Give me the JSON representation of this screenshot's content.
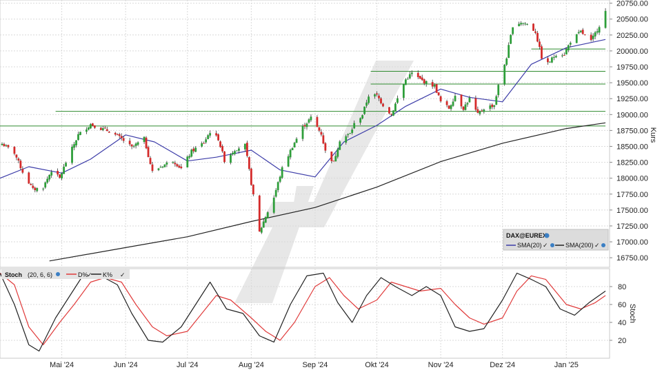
{
  "chart_data": [
    {
      "type": "candlestick",
      "instrument": "DAX@EUREX",
      "ylabel": "Kurs",
      "ylim": [
        16600,
        20800
      ],
      "yticks": [
        16750,
        17000,
        17250,
        17500,
        17750,
        18000,
        18250,
        18500,
        18750,
        19000,
        19250,
        19500,
        19750,
        20000,
        20250,
        20500,
        20750
      ],
      "ytick_labels": [
        "16750.00",
        "17000.00",
        "17250.00",
        "17500.00",
        "17750.00",
        "18000.00",
        "18250.00",
        "18500.00",
        "18750.00",
        "19000.00",
        "19250.00",
        "19500.00",
        "19750.00",
        "20000.00",
        "20250.00",
        "20500.00",
        "20750.00"
      ],
      "xlim": [
        "2024-04-01",
        "2025-01-22"
      ],
      "xticks": [
        "2024-05-01",
        "2024-06-01",
        "2024-07-01",
        "2024-08-01",
        "2024-09-01",
        "2024-10-01",
        "2024-11-01",
        "2024-12-01",
        "2025-01-01"
      ],
      "xtick_labels": [
        "Mai '24",
        "Jun '24",
        "Jul '24",
        "Aug '24",
        "Sep '24",
        "Okt '24",
        "Nov '24",
        "Dez '24",
        "Jan '25"
      ],
      "grid": true,
      "up_color": "#2e9e3a",
      "down_color": "#d42a2a",
      "close_points": [
        [
          "2024-04-02",
          18540
        ],
        [
          "2024-04-08",
          18400
        ],
        [
          "2024-04-12",
          18100
        ],
        [
          "2024-04-17",
          17820
        ],
        [
          "2024-04-22",
          17860
        ],
        [
          "2024-04-26",
          18120
        ],
        [
          "2024-04-30",
          18000
        ],
        [
          "2024-05-03",
          18250
        ],
        [
          "2024-05-09",
          18680
        ],
        [
          "2024-05-15",
          18850
        ],
        [
          "2024-05-20",
          18780
        ],
        [
          "2024-05-24",
          18740
        ],
        [
          "2024-05-30",
          18620
        ],
        [
          "2024-06-04",
          18480
        ],
        [
          "2024-06-10",
          18620
        ],
        [
          "2024-06-14",
          18100
        ],
        [
          "2024-06-19",
          18200
        ],
        [
          "2024-06-24",
          18280
        ],
        [
          "2024-06-28",
          18150
        ],
        [
          "2024-07-03",
          18420
        ],
        [
          "2024-07-09",
          18560
        ],
        [
          "2024-07-12",
          18730
        ],
        [
          "2024-07-16",
          18620
        ],
        [
          "2024-07-19",
          18280
        ],
        [
          "2024-07-24",
          18450
        ],
        [
          "2024-07-29",
          18520
        ],
        [
          "2024-08-02",
          17720
        ],
        [
          "2024-08-05",
          17150
        ],
        [
          "2024-08-08",
          17400
        ],
        [
          "2024-08-12",
          17700
        ],
        [
          "2024-08-16",
          18150
        ],
        [
          "2024-08-21",
          18500
        ],
        [
          "2024-08-26",
          18800
        ],
        [
          "2024-08-30",
          18950
        ],
        [
          "2024-09-04",
          18700
        ],
        [
          "2024-09-06",
          18420
        ],
        [
          "2024-09-10",
          18250
        ],
        [
          "2024-09-13",
          18600
        ],
        [
          "2024-09-18",
          18700
        ],
        [
          "2024-09-20",
          18850
        ],
        [
          "2024-09-24",
          19000
        ],
        [
          "2024-09-27",
          19300
        ],
        [
          "2024-10-01",
          19300
        ],
        [
          "2024-10-04",
          19150
        ],
        [
          "2024-10-08",
          19000
        ],
        [
          "2024-10-11",
          19250
        ],
        [
          "2024-10-15",
          19550
        ],
        [
          "2024-10-18",
          19650
        ],
        [
          "2024-10-22",
          19550
        ],
        [
          "2024-10-25",
          19500
        ],
        [
          "2024-10-29",
          19450
        ],
        [
          "2024-11-01",
          19200
        ],
        [
          "2024-11-05",
          19100
        ],
        [
          "2024-11-08",
          19300
        ],
        [
          "2024-11-12",
          19100
        ],
        [
          "2024-11-15",
          19250
        ],
        [
          "2024-11-19",
          19000
        ],
        [
          "2024-11-22",
          19100
        ],
        [
          "2024-11-27",
          19150
        ],
        [
          "2024-11-29",
          19450
        ],
        [
          "2024-12-03",
          19900
        ],
        [
          "2024-12-06",
          20400
        ],
        [
          "2024-12-10",
          20450
        ],
        [
          "2024-12-13",
          20420
        ],
        [
          "2024-12-17",
          20300
        ],
        [
          "2024-12-20",
          19900
        ],
        [
          "2024-12-23",
          19800
        ],
        [
          "2024-12-27",
          19950
        ],
        [
          "2024-12-31",
          19950
        ],
        [
          "2025-01-03",
          20150
        ],
        [
          "2025-01-08",
          20300
        ],
        [
          "2025-01-13",
          20150
        ],
        [
          "2025-01-17",
          20400
        ],
        [
          "2025-01-20",
          20620
        ]
      ],
      "series": [
        {
          "name": "SMA(20)",
          "color": "#3c3ca8",
          "values": [
            [
              "2024-04-01",
              18000
            ],
            [
              "2024-04-15",
              18180
            ],
            [
              "2024-05-01",
              18080
            ],
            [
              "2024-05-15",
              18300
            ],
            [
              "2024-06-01",
              18680
            ],
            [
              "2024-06-15",
              18570
            ],
            [
              "2024-07-01",
              18270
            ],
            [
              "2024-07-15",
              18330
            ],
            [
              "2024-08-01",
              18440
            ],
            [
              "2024-08-15",
              18130
            ],
            [
              "2024-09-01",
              18020
            ],
            [
              "2024-09-15",
              18570
            ],
            [
              "2024-10-01",
              18830
            ],
            [
              "2024-10-15",
              19130
            ],
            [
              "2024-11-01",
              19400
            ],
            [
              "2024-11-15",
              19270
            ],
            [
              "2024-12-01",
              19200
            ],
            [
              "2024-12-15",
              19790
            ],
            [
              "2025-01-01",
              20050
            ],
            [
              "2025-01-20",
              20180
            ]
          ]
        },
        {
          "name": "SMA(200)",
          "color": "#222222",
          "values": [
            [
              "2024-04-25",
              16700
            ],
            [
              "2024-06-01",
              16910
            ],
            [
              "2024-07-01",
              17080
            ],
            [
              "2024-08-01",
              17320
            ],
            [
              "2024-09-01",
              17540
            ],
            [
              "2024-10-01",
              17860
            ],
            [
              "2024-11-01",
              18260
            ],
            [
              "2024-12-01",
              18550
            ],
            [
              "2025-01-01",
              18780
            ],
            [
              "2025-01-20",
              18870
            ]
          ]
        }
      ],
      "support_lines": [
        {
          "value": 19680,
          "from": "2024-09-28"
        },
        {
          "value": 19480,
          "from": "2024-09-28"
        },
        {
          "value": 19050,
          "from": "2024-04-28"
        },
        {
          "value": 18820,
          "from": "2024-04-01"
        },
        {
          "value": 20030,
          "from": "2024-12-15"
        }
      ]
    },
    {
      "type": "line",
      "indicator": "Stoch",
      "ylabel": "Stoch",
      "ylim": [
        0,
        100
      ],
      "yticks": [
        20,
        40,
        60,
        80
      ],
      "ytick_labels": [
        "20",
        "40",
        "60",
        "80"
      ],
      "grid": true,
      "series": [
        {
          "name": "D%",
          "color": "#e03a3a",
          "values": [
            [
              "2024-04-01",
              95
            ],
            [
              "2024-04-08",
              82
            ],
            [
              "2024-04-15",
              35
            ],
            [
              "2024-04-22",
              15
            ],
            [
              "2024-04-30",
              40
            ],
            [
              "2024-05-07",
              60
            ],
            [
              "2024-05-15",
              85
            ],
            [
              "2024-05-22",
              90
            ],
            [
              "2024-05-30",
              85
            ],
            [
              "2024-06-06",
              60
            ],
            [
              "2024-06-14",
              35
            ],
            [
              "2024-06-21",
              25
            ],
            [
              "2024-07-01",
              30
            ],
            [
              "2024-07-08",
              50
            ],
            [
              "2024-07-15",
              70
            ],
            [
              "2024-07-22",
              65
            ],
            [
              "2024-08-01",
              45
            ],
            [
              "2024-08-08",
              30
            ],
            [
              "2024-08-15",
              20
            ],
            [
              "2024-08-22",
              40
            ],
            [
              "2024-09-01",
              80
            ],
            [
              "2024-09-08",
              90
            ],
            [
              "2024-09-15",
              70
            ],
            [
              "2024-09-22",
              55
            ],
            [
              "2024-10-01",
              65
            ],
            [
              "2024-10-08",
              85
            ],
            [
              "2024-10-15",
              80
            ],
            [
              "2024-10-22",
              75
            ],
            [
              "2024-11-01",
              78
            ],
            [
              "2024-11-08",
              60
            ],
            [
              "2024-11-15",
              45
            ],
            [
              "2024-11-22",
              38
            ],
            [
              "2024-12-01",
              45
            ],
            [
              "2024-12-08",
              75
            ],
            [
              "2024-12-15",
              92
            ],
            [
              "2024-12-22",
              88
            ],
            [
              "2025-01-01",
              60
            ],
            [
              "2025-01-08",
              55
            ],
            [
              "2025-01-15",
              62
            ],
            [
              "2025-01-20",
              70
            ]
          ]
        },
        {
          "name": "K%",
          "color": "#222222",
          "values": [
            [
              "2024-04-01",
              95
            ],
            [
              "2024-04-08",
              60
            ],
            [
              "2024-04-15",
              15
            ],
            [
              "2024-04-20",
              8
            ],
            [
              "2024-04-28",
              45
            ],
            [
              "2024-05-05",
              70
            ],
            [
              "2024-05-12",
              95
            ],
            [
              "2024-05-20",
              92
            ],
            [
              "2024-05-28",
              82
            ],
            [
              "2024-06-04",
              50
            ],
            [
              "2024-06-12",
              20
            ],
            [
              "2024-06-19",
              18
            ],
            [
              "2024-06-28",
              35
            ],
            [
              "2024-07-05",
              60
            ],
            [
              "2024-07-12",
              85
            ],
            [
              "2024-07-20",
              55
            ],
            [
              "2024-07-28",
              50
            ],
            [
              "2024-08-05",
              25
            ],
            [
              "2024-08-12",
              18
            ],
            [
              "2024-08-20",
              60
            ],
            [
              "2024-08-28",
              92
            ],
            [
              "2024-09-05",
              95
            ],
            [
              "2024-09-12",
              62
            ],
            [
              "2024-09-19",
              40
            ],
            [
              "2024-09-26",
              70
            ],
            [
              "2024-10-03",
              90
            ],
            [
              "2024-10-10",
              80
            ],
            [
              "2024-10-18",
              70
            ],
            [
              "2024-10-25",
              80
            ],
            [
              "2024-11-01",
              70
            ],
            [
              "2024-11-08",
              35
            ],
            [
              "2024-11-15",
              30
            ],
            [
              "2024-11-22",
              33
            ],
            [
              "2024-12-01",
              65
            ],
            [
              "2024-12-08",
              95
            ],
            [
              "2024-12-15",
              88
            ],
            [
              "2024-12-22",
              80
            ],
            [
              "2024-12-29",
              55
            ],
            [
              "2025-01-05",
              48
            ],
            [
              "2025-01-12",
              62
            ],
            [
              "2025-01-20",
              75
            ]
          ]
        }
      ]
    }
  ],
  "legend": {
    "instrument": "DAX@EUREX",
    "sma20": "SMA(20)",
    "sma200": "SMA(200)",
    "stoch_title": "Stoch",
    "stoch_params": "(20, 6, 6)",
    "d_label": "D%",
    "k_label": "K%"
  },
  "watermark": {
    "color": "#d0d0d0"
  },
  "icons": [
    "globe-icon",
    "check-icon"
  ]
}
